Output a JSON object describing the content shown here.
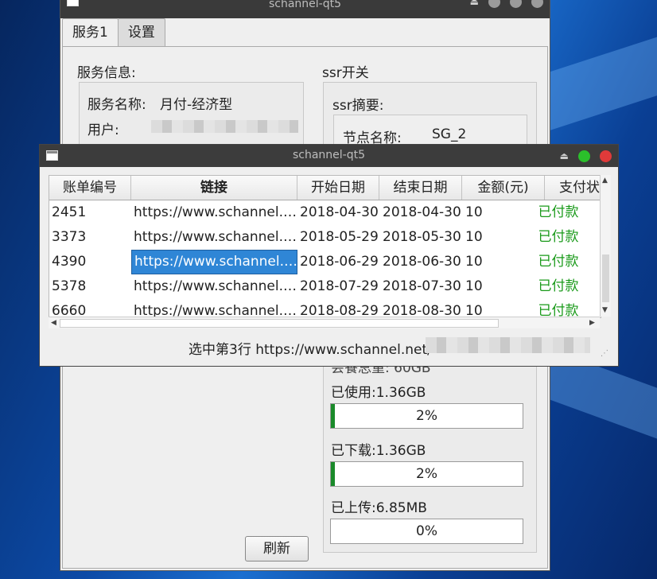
{
  "back_window": {
    "title": "schannel-qt5",
    "tabs": [
      "服务1",
      "设置"
    ],
    "service_info_label": "服务信息:",
    "service_name_label": "服务名称:",
    "service_name_value": "月付-经济型",
    "user_label": "用户:",
    "ssr_switch_label": "ssr开关",
    "ssr_summary_label": "ssr摘要:",
    "node_name_label": "节点名称:",
    "node_name_value": "SG_2",
    "total_traffic_partial": "会餐总重:  60GB",
    "used_label": "已使用:1.36GB",
    "used_percent": "2%",
    "used_fraction": 0.02,
    "downloaded_label": "已下载:1.36GB",
    "downloaded_percent": "2%",
    "downloaded_fraction": 0.02,
    "uploaded_label": "已上传:6.85MB",
    "uploaded_percent": "0%",
    "uploaded_fraction": 0.0,
    "refresh_button": "刷新"
  },
  "front_window": {
    "title": "schannel-qt5",
    "columns": [
      "账单编号",
      "链接",
      "开始日期",
      "结束日期",
      "金额(元)",
      "支付状"
    ],
    "rows": [
      {
        "id": "2451",
        "link": "https://www.schannel.…",
        "start": "2018-04-30",
        "end": "2018-04-30",
        "amount": "10",
        "status": "已付款"
      },
      {
        "id": "3373",
        "link": "https://www.schannel.…",
        "start": "2018-05-29",
        "end": "2018-05-30",
        "amount": "10",
        "status": "已付款"
      },
      {
        "id": "4390",
        "link": "https://www.schannel.…",
        "start": "2018-06-29",
        "end": "2018-06-30",
        "amount": "10",
        "status": "已付款"
      },
      {
        "id": "5378",
        "link": "https://www.schannel.…",
        "start": "2018-07-29",
        "end": "2018-07-30",
        "amount": "10",
        "status": "已付款"
      },
      {
        "id": "6660",
        "link": "https://www.schannel.…",
        "start": "2018-08-29",
        "end": "2018-08-30",
        "amount": "10",
        "status": "已付款"
      }
    ],
    "selected_row_index": 2,
    "status_text": "选中第3行 https://www.schannel.net/"
  },
  "colors": {
    "paid": "#1a9a1a",
    "selection": "#2f86d6",
    "progress": "#1a8a2a",
    "close": "#e03a3a",
    "maximize": "#2bc02b"
  },
  "icons": [
    "window-menu-icon",
    "shade-icon",
    "minimize-icon",
    "maximize-icon",
    "close-icon"
  ]
}
